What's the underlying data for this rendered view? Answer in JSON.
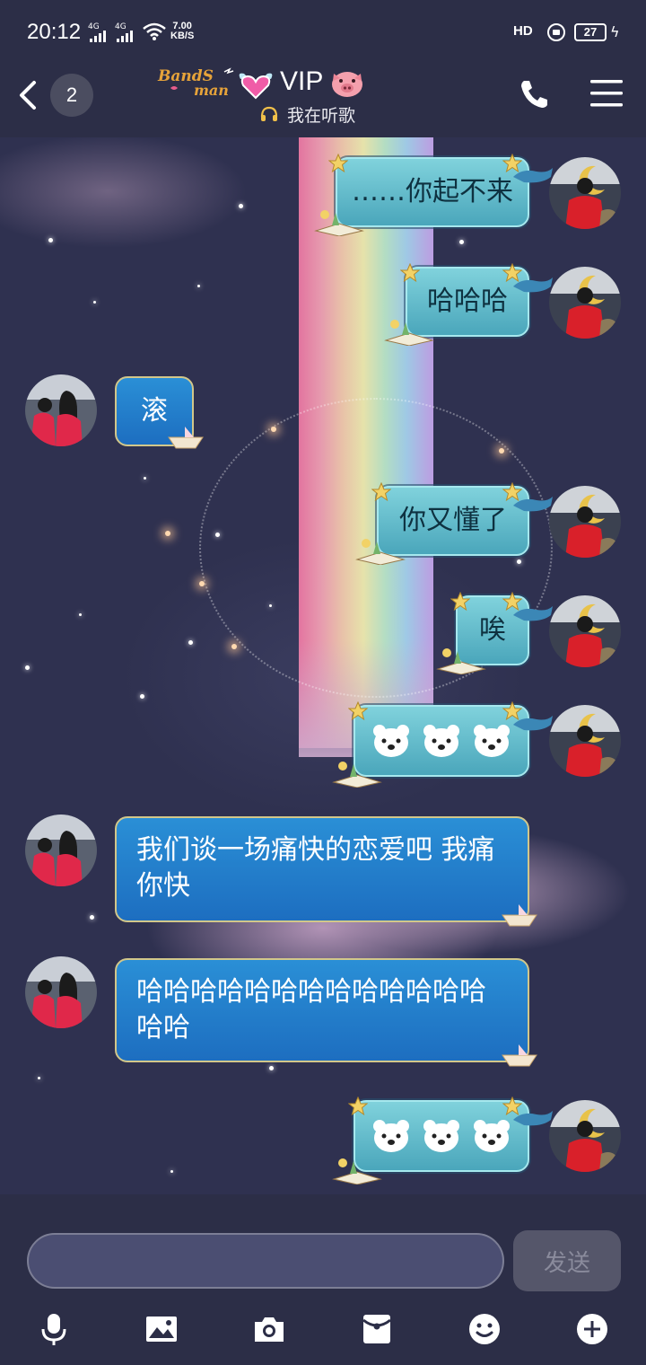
{
  "status_bar": {
    "time": "20:12",
    "signal1_label": "4G",
    "signal2_label": "4G",
    "net_speed_value": "7.00",
    "net_speed_unit": "KB/S",
    "hd_label": "HD",
    "battery": "27"
  },
  "header": {
    "back_icon": "chevron-left-icon",
    "unread_count": "2",
    "brand_logo_text": "BandSman",
    "vip_label": "VIP",
    "status_text": "我在听歌",
    "call_icon": "phone-icon",
    "menu_icon": "hamburger-menu-icon"
  },
  "messages": [
    {
      "side": "right",
      "text": "……你起不来"
    },
    {
      "side": "right",
      "text": "哈哈哈"
    },
    {
      "side": "left",
      "text": "滚"
    },
    {
      "side": "right",
      "text": "你又懂了"
    },
    {
      "side": "right",
      "text": "唉"
    },
    {
      "side": "right",
      "emoji": "polar-bear-face-icon x3"
    },
    {
      "side": "left",
      "text": "我们谈一场痛快的恋爱吧 我痛你快"
    },
    {
      "side": "left",
      "text": "哈哈哈哈哈哈哈哈哈哈哈哈哈哈哈"
    },
    {
      "side": "right",
      "emoji": "polar-bear-face-icon x3"
    }
  ],
  "composer": {
    "input_value": "",
    "input_placeholder": "",
    "send_label": "发送"
  },
  "toolbar": {
    "icons": [
      "microphone-icon",
      "image-icon",
      "camera-icon",
      "red-packet-icon",
      "emoji-icon",
      "plus-icon"
    ]
  },
  "colors": {
    "bar_background": "#2c2e47",
    "teal_bubble": "#6cc4d0",
    "blue_bubble": "#2185cf",
    "send_button": "#55566a"
  }
}
